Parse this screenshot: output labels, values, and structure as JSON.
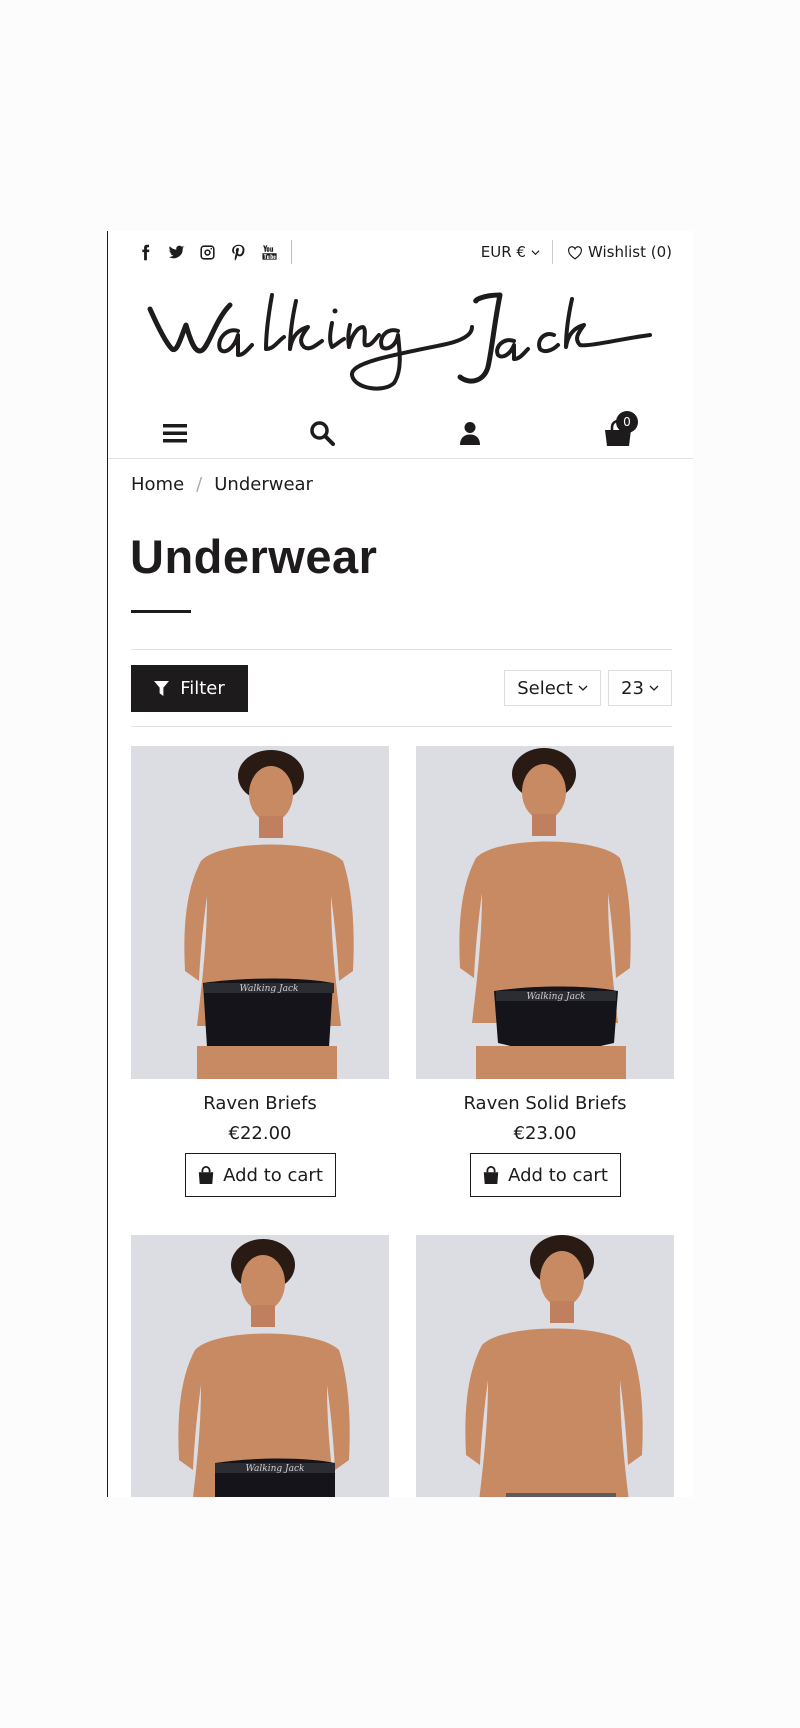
{
  "header": {
    "social_icons": [
      "facebook-icon",
      "twitter-icon",
      "instagram-icon",
      "pinterest-icon",
      "youtube-icon"
    ],
    "currency": "EUR €",
    "wishlist": "Wishlist (0)",
    "brand": "Walking Jack",
    "nav_icons": [
      "menu-icon",
      "search-icon",
      "user-icon",
      "cart-icon"
    ],
    "cart_count": "0"
  },
  "breadcrumb": {
    "home": "Home",
    "separator": "/",
    "current": "Underwear"
  },
  "page": {
    "title": "Underwear"
  },
  "toolbar": {
    "filter_label": "Filter",
    "sort_value": "Select",
    "per_page_value": "23"
  },
  "products": [
    {
      "name": "Raven Briefs",
      "price": "€22.00",
      "cta": "Add to cart",
      "waistband": "Walking Jack"
    },
    {
      "name": "Raven Solid Briefs",
      "price": "€23.00",
      "cta": "Add to cart",
      "waistband": "Walking Jack"
    },
    {
      "name": "",
      "price": "",
      "cta": "",
      "waistband": "Walking Jack"
    },
    {
      "name": "",
      "price": "",
      "cta": "",
      "waistband": ""
    }
  ],
  "colors": {
    "ink": "#1e1b1c",
    "photo_bg": "#dcdde3",
    "skin": "#c88a63",
    "hair": "#2a1a14"
  }
}
